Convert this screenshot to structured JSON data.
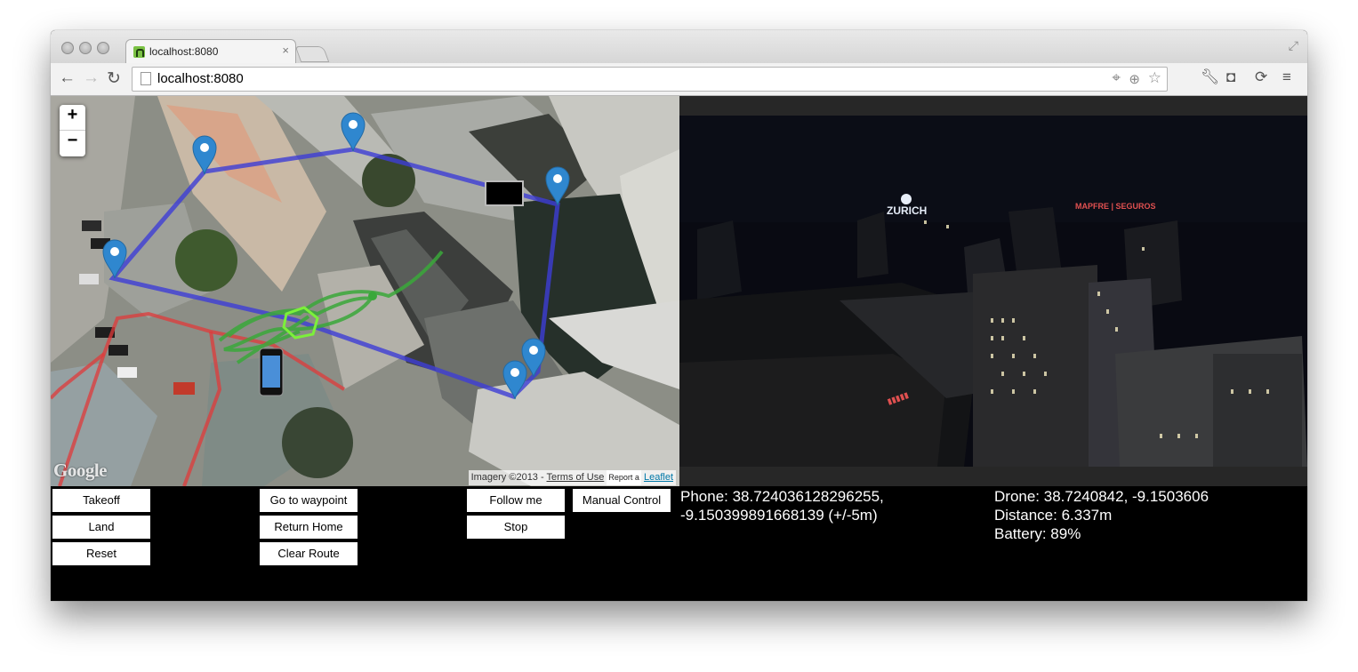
{
  "browser": {
    "tab_title": "localhost:8080",
    "tab_close": "×",
    "url": "localhost:8080",
    "icons": [
      "back-icon",
      "forward-icon",
      "reload-icon",
      "page-icon",
      "location-icon",
      "zoom-icon",
      "star-icon",
      "wrench-icon",
      "pocket-icon",
      "sync-icon",
      "menu-icon",
      "fullscreen-icon"
    ]
  },
  "map": {
    "zoom_in": "+",
    "zoom_out": "−",
    "google_logo": "Google",
    "attribution_imagery": "Imagery ©2013 - ",
    "attribution_terms": "Terms of Use",
    "attribution_report": "Report a",
    "attribution_leaflet": "Leaflet",
    "route_color": "#3d3dd6",
    "trail_color": "#3aa83a",
    "boundary_color": "#e03a3a",
    "marker_color": "#2f87cf"
  },
  "controls": {
    "takeoff": "Takeoff",
    "land": "Land",
    "reset": "Reset",
    "go_to_waypoint": "Go to waypoint",
    "return_home": "Return Home",
    "clear_route": "Clear Route",
    "follow_me": "Follow me",
    "stop": "Stop",
    "manual_control": "Manual Control"
  },
  "status": {
    "phone_line1": "Phone: 38.724036128296255,",
    "phone_line2": "-9.150399891668139 (+/-5m)",
    "drone": "Drone: 38.7240842, -9.1503606",
    "distance": "Distance: 6.337m",
    "battery": "Battery: 89%"
  },
  "video": {
    "sign_zurich": "ZURICH",
    "sign_red": "MAPFRE | SEGUROS"
  }
}
